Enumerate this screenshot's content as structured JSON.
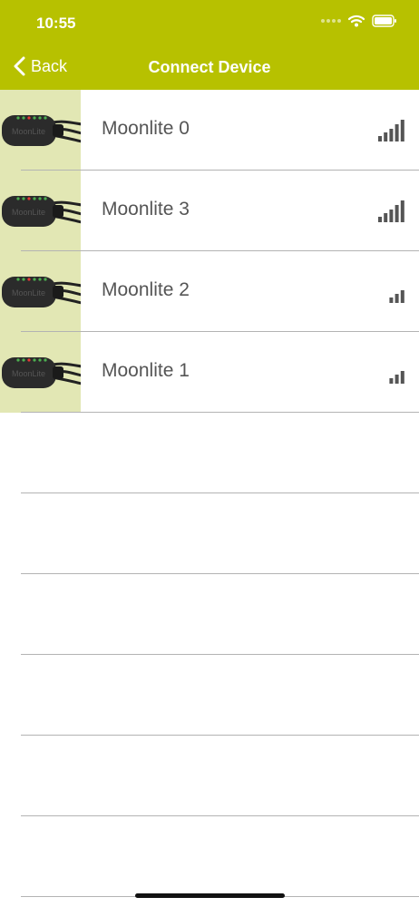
{
  "status_bar": {
    "time": "10:55"
  },
  "nav": {
    "back_label": "Back",
    "title": "Connect Device"
  },
  "devices": [
    {
      "name": "Moonlite 0",
      "signal_bars": 5
    },
    {
      "name": "Moonlite 3",
      "signal_bars": 5
    },
    {
      "name": "Moonlite 2",
      "signal_bars": 3
    },
    {
      "name": "Moonlite 1",
      "signal_bars": 3
    }
  ],
  "colors": {
    "header": "#b7c100",
    "thumb_bg": "#e2e7b4",
    "text": "#555555"
  },
  "device_image_text": "MoonLite"
}
